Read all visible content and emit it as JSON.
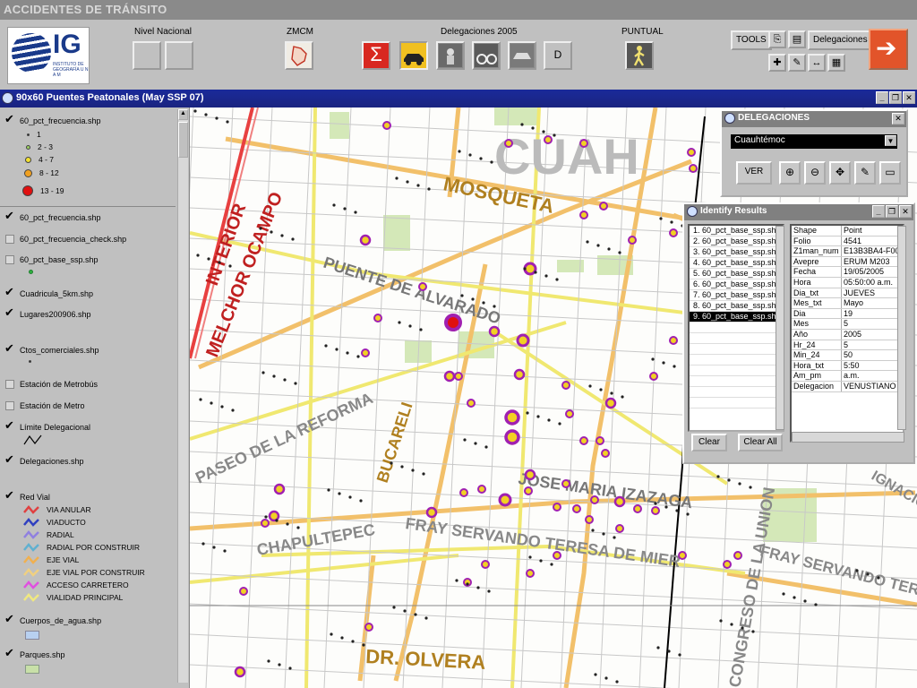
{
  "app": {
    "title": "ACCIDENTES DE TRÁNSITO"
  },
  "logo": {
    "text": "IG",
    "subtitle": "INSTITUTO DE GEOGRAFÍA U N A M"
  },
  "toolbar": {
    "nivel_nacional": "Nivel Nacional",
    "zmcm": "ZMCM",
    "delegaciones_2005": "Delegaciones 2005",
    "d_button": "D",
    "puntual": "PUNTUAL",
    "tools": "TOOLS",
    "delegaciones": "Delegaciones",
    "sigma": "Σ"
  },
  "view": {
    "title": "90x60 Puentes Peatonales (May SSP 07)"
  },
  "legend": {
    "layers": [
      {
        "label": "60_pct_frecuencia.shp",
        "checked": true
      },
      {
        "label": "60_pct_frecuencia.shp",
        "checked": true
      },
      {
        "label": "60_pct_frecuencia_check.shp",
        "checked": false
      },
      {
        "label": "60_pct_base_ssp.shp",
        "checked": false
      },
      {
        "label": "Cuadricula_5km.shp",
        "checked": true
      },
      {
        "label": "Lugares200906.shp",
        "checked": true
      },
      {
        "label": "Ctos_comerciales.shp",
        "checked": true
      },
      {
        "label": "Estación de Metrobús",
        "checked": false
      },
      {
        "label": "Estación de Metro",
        "checked": false
      },
      {
        "label": "Límite Delegacional",
        "checked": true
      },
      {
        "label": "Delegaciones.shp",
        "checked": true
      },
      {
        "label": "Red Vial",
        "checked": true
      },
      {
        "label": "Cuerpos_de_agua.shp",
        "checked": true
      },
      {
        "label": "Parques.shp",
        "checked": true
      }
    ],
    "frequency_classes": [
      "1",
      "2 - 3",
      "4 - 7",
      "8 - 12",
      "13 - 19"
    ],
    "red_vial_classes": [
      "VIA ANULAR",
      "VIADUCTO",
      "RADIAL",
      "RADIAL POR CONSTRUIR",
      "EJE VIAL",
      "EJE VIAL POR CONSTRUIR",
      "ACCESO CARRETERO",
      "VIALIDAD PRINCIPAL"
    ]
  },
  "delegaciones_win": {
    "title": "DELEGACIONES",
    "selected": "Cuauhtémoc",
    "ver": "VER"
  },
  "identify": {
    "title": "Identify Results",
    "items": [
      "1. 60_pct_base_ssp.sh",
      "2. 60_pct_base_ssp.sh",
      "3. 60_pct_base_ssp.sh",
      "4. 60_pct_base_ssp.sh",
      "5. 60_pct_base_ssp.sh",
      "6. 60_pct_base_ssp.sh",
      "7. 60_pct_base_ssp.sh",
      "8. 60_pct_base_ssp.sh",
      "9. 60_pct_base_ssp.sh"
    ],
    "fields": [
      [
        "Shape",
        "Point"
      ],
      [
        "Folio",
        "4541"
      ],
      [
        "Z1man_num",
        "E13B3BA4-F00"
      ],
      [
        "Avepre",
        "ERUM M203"
      ],
      [
        "Fecha",
        "19/05/2005"
      ],
      [
        "Hora",
        "05:50:00 a.m."
      ],
      [
        "Dia_txt",
        "JUEVES"
      ],
      [
        "Mes_txt",
        "Mayo"
      ],
      [
        "Dia",
        "19"
      ],
      [
        "Mes",
        "5"
      ],
      [
        "Año",
        "2005"
      ],
      [
        "Hr_24",
        "5"
      ],
      [
        "Min_24",
        "50"
      ],
      [
        "Hora_txt",
        "5:50"
      ],
      [
        "Am_pm",
        "a.m."
      ],
      [
        "Delegacion",
        "VENUSTIANO"
      ]
    ],
    "clear": "Clear",
    "clear_all": "Clear All"
  },
  "map": {
    "street_labels": [
      "CUAH",
      "MOSQUETA",
      "PUENTE DE ALVARADO",
      "INTERIOR",
      "MELCHOR OCAMPO",
      "PASEO DE LA REFORMA",
      "BUCARELI",
      "JOSE MARIA IZAZAGA",
      "CHAPULTEPEC",
      "FRAY SERVANDO TERESA DE MIER",
      "FRAY SERVANDO TERE",
      "DR. OLVERA",
      "CONGRESO DE LA UNION",
      "IGNACIO"
    ]
  },
  "colors": {
    "title_bar": "#1a2480",
    "accident_fill": "#f2d024",
    "accident_ring": "#a020b0",
    "max_point": "#e01010",
    "eje_vial": "#f2c06a"
  }
}
